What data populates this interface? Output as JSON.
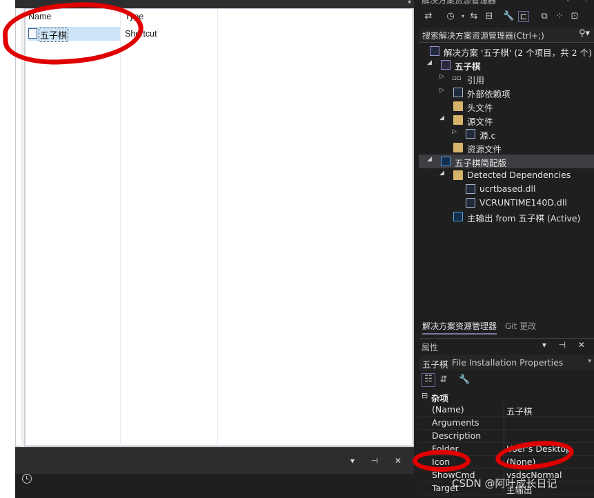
{
  "file_system": {
    "columns": [
      "Name",
      "Type"
    ],
    "rows": [
      {
        "name": "五子棋",
        "type": "Shortcut"
      }
    ]
  },
  "solution_explorer": {
    "title": "解决方案资源管理器",
    "search_placeholder": "搜索解决方案资源管理器(Ctrl+;)",
    "tree": [
      {
        "label": "解决方案 '五子棋' (2 个项目，共 2 个)",
        "level": 0,
        "icon": "solution-icon"
      },
      {
        "label": "五子棋",
        "level": 1,
        "icon": "project-icon",
        "bold": true,
        "expanded": true
      },
      {
        "label": "引用",
        "level": 2,
        "icon": "references-icon",
        "expanded": false
      },
      {
        "label": "外部依赖项",
        "level": 2,
        "icon": "external-deps-icon",
        "expanded": false
      },
      {
        "label": "头文件",
        "level": 2,
        "icon": "filter-folder-icon"
      },
      {
        "label": "源文件",
        "level": 2,
        "icon": "filter-folder-icon",
        "expanded": true
      },
      {
        "label": "源.c",
        "level": 3,
        "icon": "c-file-icon",
        "expanded": false
      },
      {
        "label": "资源文件",
        "level": 2,
        "icon": "filter-folder-icon"
      },
      {
        "label": "五子棋简配版",
        "level": 1,
        "icon": "setup-project-icon",
        "expanded": true,
        "selected": true
      },
      {
        "label": "Detected Dependencies",
        "level": 2,
        "icon": "folder-icon",
        "expanded": true
      },
      {
        "label": "ucrtbased.dll",
        "level": 3,
        "icon": "dll-icon"
      },
      {
        "label": "VCRUNTIME140D.dll",
        "level": 3,
        "icon": "dll-icon"
      },
      {
        "label": "主输出 from 五子棋 (Active)",
        "level": 2,
        "icon": "primary-output-icon"
      }
    ],
    "tabs": [
      "解决方案资源管理器",
      "Git 更改"
    ]
  },
  "properties": {
    "title": "属性",
    "object_name": "五子棋",
    "object_type": "File Installation Properties",
    "category": "杂项",
    "rows": [
      {
        "name": "(Name)",
        "value": "五子棋"
      },
      {
        "name": "Arguments",
        "value": ""
      },
      {
        "name": "Description",
        "value": ""
      },
      {
        "name": "Folder",
        "value": "User's Desktop"
      },
      {
        "name": "Icon",
        "value": "(None)"
      },
      {
        "name": "ShowCmd",
        "value": "vsdscNormal"
      },
      {
        "name": "Target",
        "value": "主输出"
      }
    ]
  },
  "watermark": "CSDN @阿叶成长日记",
  "colors": {
    "annotation": "#e00000",
    "selection": "#cce4f7",
    "dark_bg": "#1f1f1f"
  }
}
